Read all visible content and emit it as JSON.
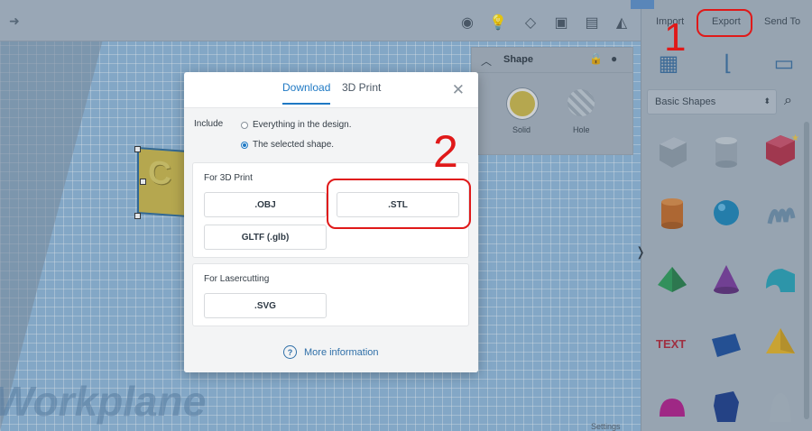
{
  "toolbar": {
    "export_options": [
      "Import",
      "Export",
      "Send To"
    ]
  },
  "shape_panel": {
    "title": "Shape",
    "solid_label": "Solid",
    "hole_label": "Hole",
    "solid_color": "#c9b64a"
  },
  "library": {
    "dropdown_value": "Basic Shapes"
  },
  "workplane": {
    "label": "Workplane",
    "settings_label": "Settings"
  },
  "dialog": {
    "tabs": [
      {
        "label": "Download",
        "active": true
      },
      {
        "label": "3D Print",
        "active": false
      }
    ],
    "include_label": "Include",
    "include_options": [
      {
        "label": "Everything in the design.",
        "selected": false
      },
      {
        "label": "The selected shape.",
        "selected": true
      }
    ],
    "print_section": {
      "title": "For 3D Print",
      "formats": [
        ".OBJ",
        ".STL",
        "GLTF (.glb)"
      ]
    },
    "laser_section": {
      "title": "For Lasercutting",
      "formats": [
        ".SVG"
      ]
    },
    "more_info": "More information"
  },
  "annotations": {
    "step1": "1",
    "step2": "2",
    "color": "#e01919"
  },
  "colors": {
    "accent": "#1f79c4",
    "workplane": "#8fb5d6"
  }
}
